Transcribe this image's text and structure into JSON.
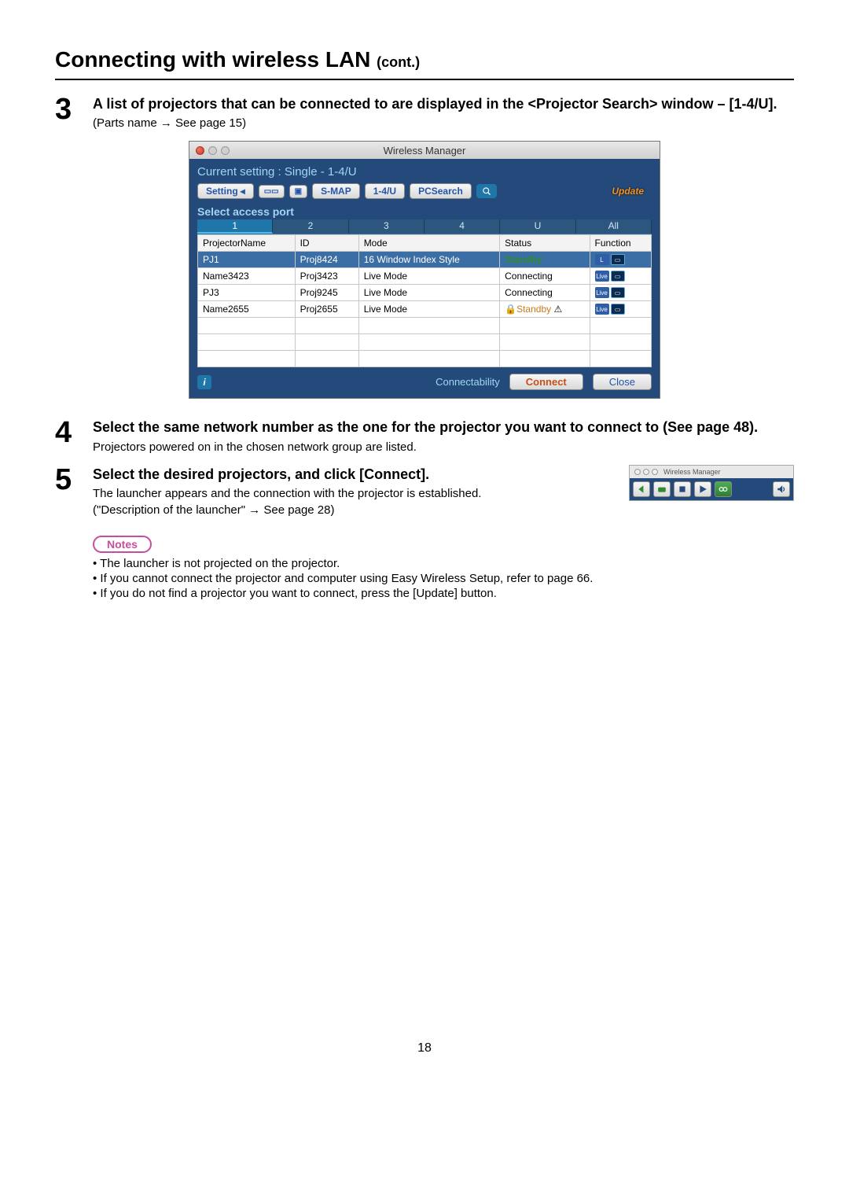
{
  "page": {
    "title_main": "Connecting with wireless LAN",
    "title_cont": "(cont.)",
    "number": "18"
  },
  "step3": {
    "num": "3",
    "title": "A list of projectors that can be connected to are displayed in the <Projector Search> window – [1-4/U].",
    "sub": "(Parts name → See page 15)"
  },
  "wm": {
    "title": "Wireless Manager",
    "current": "Current setting : Single - 1-4/U",
    "toolbar": {
      "setting": "Setting",
      "smap": "S-MAP",
      "oneFourU": "1-4/U",
      "pcsearch": "PCSearch",
      "update": "Update"
    },
    "select_port_label": "Select access port",
    "tabs": [
      "1",
      "2",
      "3",
      "4",
      "U",
      "All"
    ],
    "columns": {
      "name": "ProjectorName",
      "id": "ID",
      "mode": "Mode",
      "status": "Status",
      "func": "Function"
    },
    "rows": [
      {
        "name": "PJ1",
        "id": "Proj8424",
        "mode": "16 Window Index Style",
        "status": "Standby",
        "selected": true,
        "lock": false
      },
      {
        "name": "Name3423",
        "id": "Proj3423",
        "mode": "Live Mode",
        "status": "Connecting",
        "selected": false,
        "lock": false
      },
      {
        "name": "PJ3",
        "id": "Proj9245",
        "mode": "Live Mode",
        "status": "Connecting",
        "selected": false,
        "lock": false
      },
      {
        "name": "Name2655",
        "id": "Proj2655",
        "mode": "Live Mode",
        "status": "Standby",
        "selected": false,
        "lock": true
      }
    ],
    "footer": {
      "connectability": "Connectability",
      "connect": "Connect",
      "close": "Close"
    }
  },
  "step4": {
    "num": "4",
    "title": "Select the same network number as the one for the projector you want to connect to (See page 48).",
    "sub": "Projectors powered on in the chosen network group are listed."
  },
  "step5": {
    "num": "5",
    "title": "Select the desired projectors, and click [Connect].",
    "sub1": "The launcher appears and the connection with the projector is established.",
    "sub2": "(\"Description of the launcher\" → See page 28)",
    "launcher_title": "Wireless Manager"
  },
  "notes": {
    "label": "Notes",
    "items": [
      "The launcher is not projected on the projector.",
      "If you cannot connect the projector and computer using Easy Wireless Setup, refer to page 66.",
      "If you do not find a projector you want to connect, press the [Update] button."
    ]
  }
}
